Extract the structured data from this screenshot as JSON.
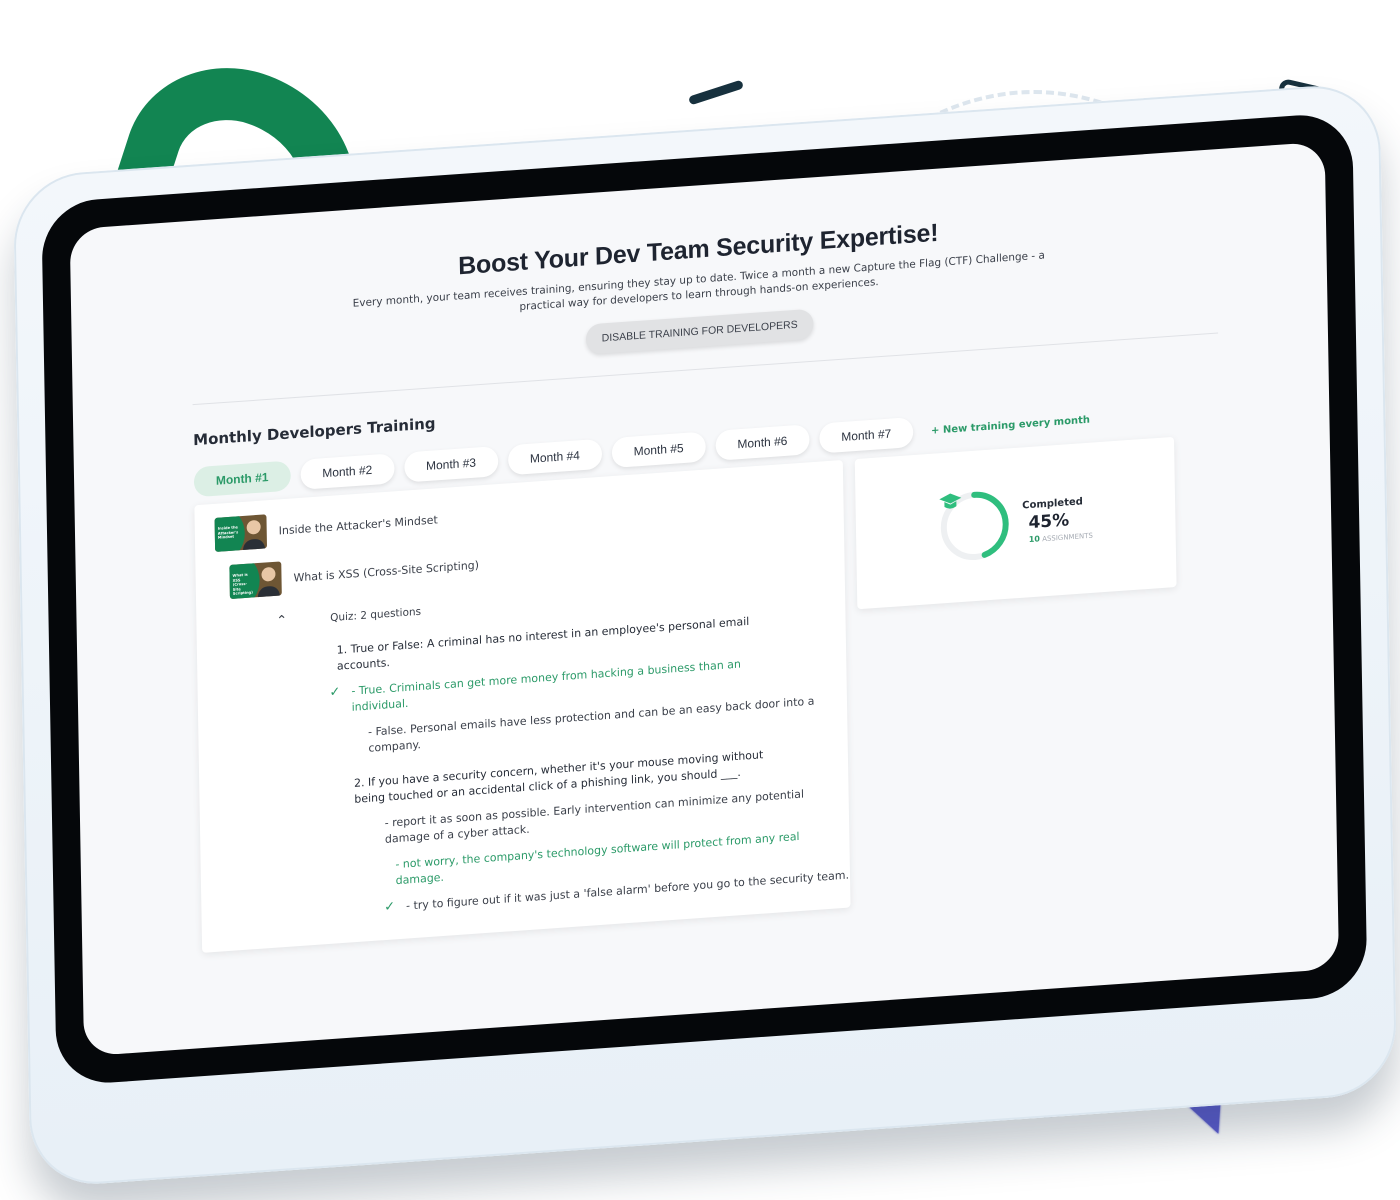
{
  "hero": {
    "title": "Boost Your Dev Team Security Expertise!",
    "description": "Every month, your team receives training, ensuring they stay up to date. Twice a month a new Capture the Flag (CTF) Challenge - a practical way for developers to learn through hands-on experiences.",
    "disable_button": "DISABLE TRAINING FOR DEVELOPERS"
  },
  "training": {
    "title": "Monthly Developers Training",
    "tabs": [
      {
        "label": "Month #1",
        "active": true
      },
      {
        "label": "Month #2"
      },
      {
        "label": "Month #3"
      },
      {
        "label": "Month #4"
      },
      {
        "label": "Month #5"
      },
      {
        "label": "Month #6"
      },
      {
        "label": "Month #7"
      }
    ],
    "new_training_link": "+ New training every month"
  },
  "lessons": [
    {
      "title": "Inside the Attacker's Mindset",
      "thumb_text": "Inside the Attacker's Mindset"
    },
    {
      "title": "What is XSS (Cross-Site Scripting)",
      "thumb_text": "What is XSS (Cross-Site Scripting)"
    }
  ],
  "quiz": {
    "header": "Quiz: 2 questions",
    "questions": [
      {
        "text": "1.  True or False: A criminal has no interest in an employee's personal email accounts.",
        "options": [
          {
            "text": "- True. Criminals can get more money from hacking a business than an individual.",
            "highlighted": true,
            "checked": true
          },
          {
            "text": "- False. Personal emails have less protection and can be an easy back door into a company.",
            "highlighted": false,
            "checked": false
          }
        ]
      },
      {
        "text": "2.  If you have a security concern, whether it's your mouse moving without being touched or an accidental click of a phishing link, you should ___.",
        "options": [
          {
            "text": "- report it as soon as possible. Early intervention can minimize any potential damage of a cyber attack.",
            "highlighted": false,
            "checked": false
          },
          {
            "text": "- not worry, the company's technology software will protect from any real damage.",
            "highlighted": true,
            "checked": false
          },
          {
            "text": "- try to figure out if it was just a 'false alarm' before you go to the security team.",
            "highlighted": false,
            "checked": true
          }
        ]
      }
    ]
  },
  "progress": {
    "label": "Completed",
    "percent": 45,
    "percent_text": "45%",
    "assignments_count": "10",
    "assignments_label": "ASSIGNMENTS"
  },
  "colors": {
    "accent_green": "#2b9a68",
    "brand_green": "#128552",
    "orange": "#f5993c",
    "navy": "#17313e",
    "red": "#dc3f5b",
    "yellow": "#fbba06",
    "purple": "#5b5bd0"
  },
  "icons": {
    "progress_icon": "graduation-cap-icon",
    "collapse_icon": "chevron-up-icon",
    "correct_icon": "checkmark-icon"
  }
}
